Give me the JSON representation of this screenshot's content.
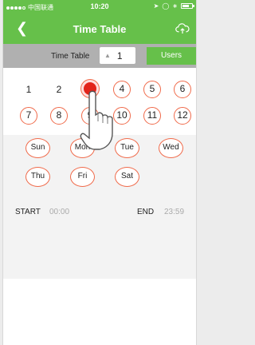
{
  "status_bar": {
    "carrier": "中国联通",
    "time": "10:20"
  },
  "nav": {
    "title": "Time Table",
    "back_icon": "chevron-left-icon",
    "upload_icon": "cloud-upload-icon"
  },
  "selector": {
    "label": "Time Table",
    "value": "1",
    "users_label": "Users"
  },
  "hours": [
    {
      "label": "1",
      "state": "plain"
    },
    {
      "label": "2",
      "state": "plain"
    },
    {
      "label": "3",
      "state": "active"
    },
    {
      "label": "4",
      "state": "ring"
    },
    {
      "label": "5",
      "state": "ring"
    },
    {
      "label": "6",
      "state": "ring"
    },
    {
      "label": "7",
      "state": "ring"
    },
    {
      "label": "8",
      "state": "ring"
    },
    {
      "label": "9",
      "state": "ring"
    },
    {
      "label": "10",
      "state": "ring"
    },
    {
      "label": "11",
      "state": "ring"
    },
    {
      "label": "12",
      "state": "ring"
    }
  ],
  "days": [
    "Sun",
    "Mon",
    "Tue",
    "Wed",
    "Thu",
    "Fri",
    "Sat"
  ],
  "time_range": {
    "start_label": "START",
    "start_value": "00:00",
    "end_label": "END",
    "end_value": "23:59"
  },
  "colors": {
    "accent_green": "#66c04a",
    "ring_orange": "#f06a4a",
    "active_red": "#e2231a"
  }
}
